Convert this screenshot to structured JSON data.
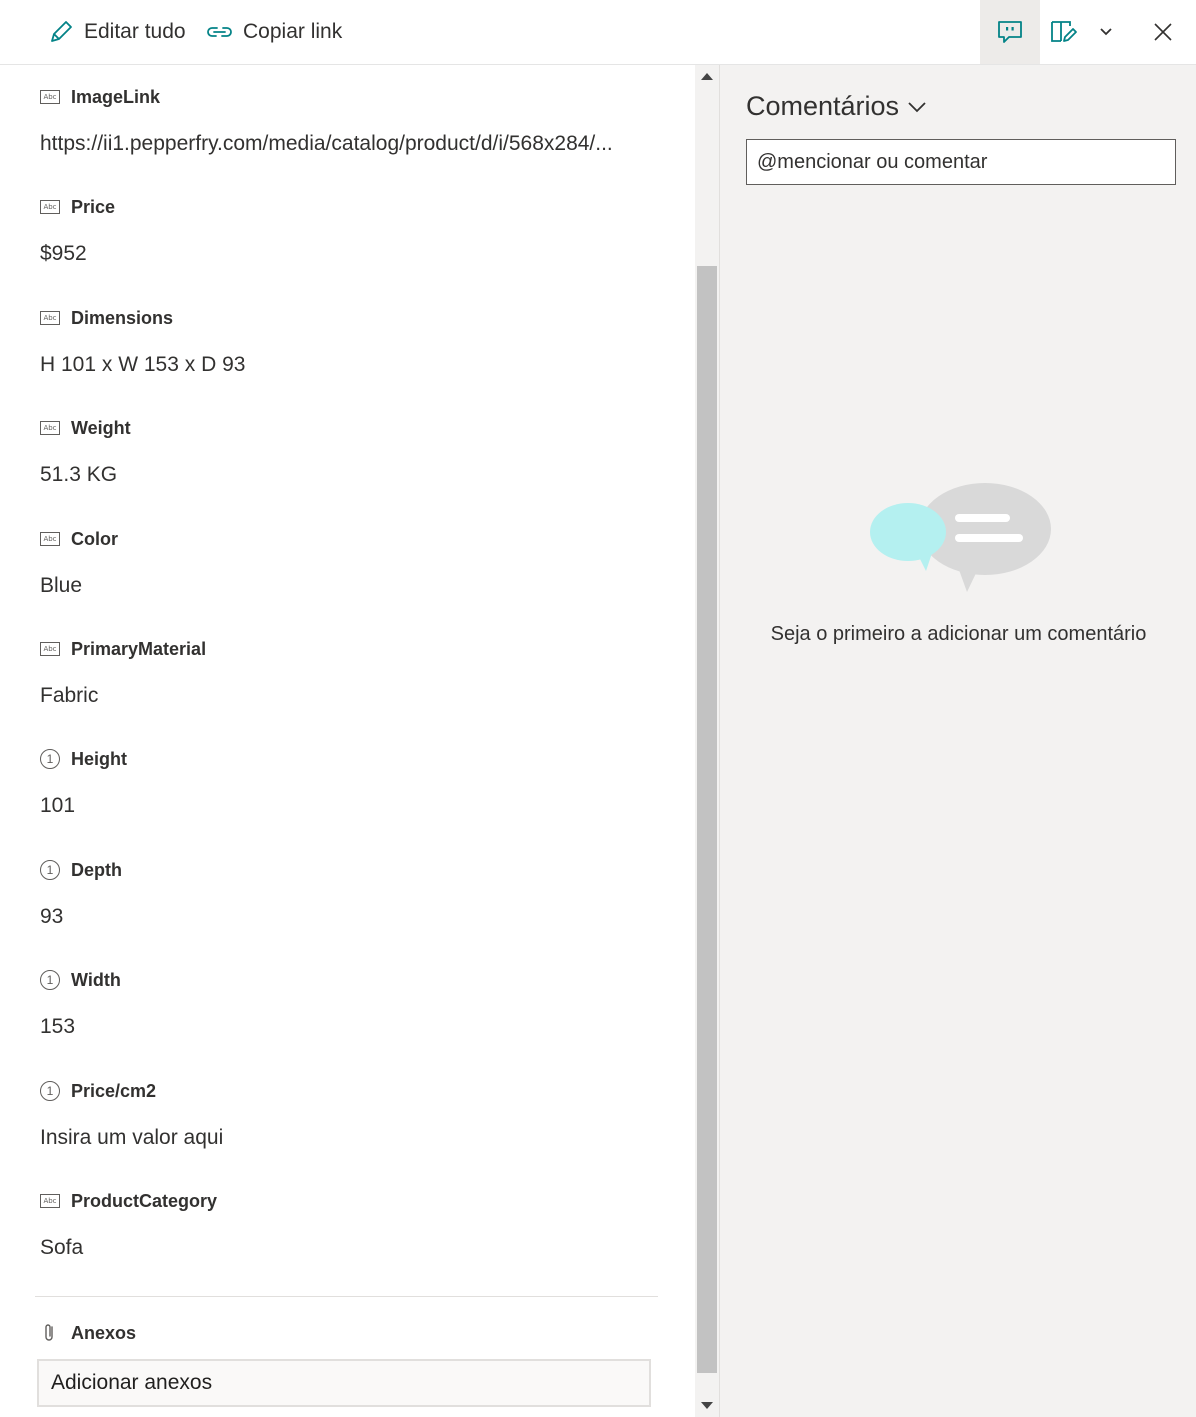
{
  "toolbar": {
    "edit_all": "Editar tudo",
    "copy_link": "Copiar link"
  },
  "fields": [
    {
      "label": "ImageLink",
      "value": "https://ii1.pepperfry.com/media/catalog/product/d/i/568x284/...",
      "icon": "abc-text-icon"
    },
    {
      "label": "Price",
      "value": "$952",
      "icon": "abc-text-icon"
    },
    {
      "label": "Dimensions",
      "value": "H 101 x W 153 x D 93",
      "icon": "abc-text-icon"
    },
    {
      "label": "Weight",
      "value": "51.3 KG",
      "icon": "abc-text-icon"
    },
    {
      "label": "Color",
      "value": "Blue",
      "icon": "abc-text-icon"
    },
    {
      "label": "PrimaryMaterial",
      "value": "Fabric",
      "icon": "abc-text-icon"
    },
    {
      "label": "Height",
      "value": "101",
      "icon": "number-icon"
    },
    {
      "label": "Depth",
      "value": "93",
      "icon": "number-icon"
    },
    {
      "label": "Width",
      "value": "153",
      "icon": "number-icon"
    },
    {
      "label": "Price/cm2",
      "value": "Insira um valor aqui",
      "icon": "number-icon"
    },
    {
      "label": "ProductCategory",
      "value": "Sofa",
      "icon": "abc-text-icon"
    }
  ],
  "attachments": {
    "label": "Anexos",
    "add_button": "Adicionar anexos"
  },
  "comments": {
    "title": "Comentários",
    "placeholder": "@mencionar ou comentar",
    "empty_text": "Seja o primeiro a adicionar um comentário"
  },
  "icon_glyphs": {
    "abc": "Abc",
    "number": "1"
  },
  "colors": {
    "accent": "#038387",
    "bubble_cyan": "#b4f0f0",
    "bubble_gray": "#d9d9d9"
  }
}
